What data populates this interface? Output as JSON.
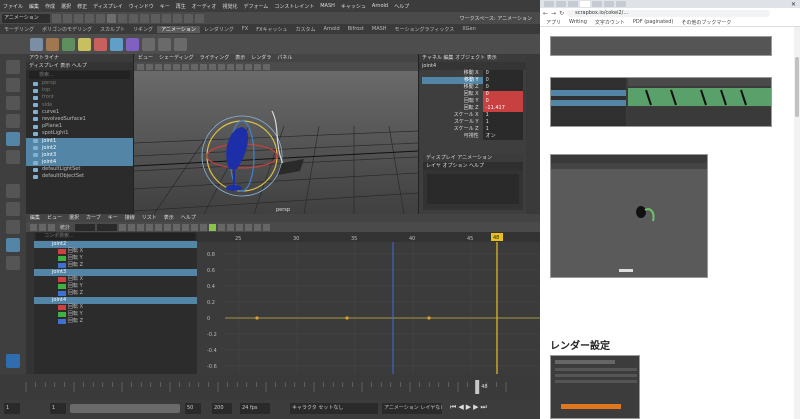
{
  "maya": {
    "menu": [
      "ファイル",
      "編集",
      "作成",
      "選択",
      "修正",
      "ディスプレイ",
      "ウィンドウ",
      "キー",
      "再生",
      "オーディオ",
      "視覚化",
      "デフォーム",
      "コンストレイント",
      "MASH",
      "キャッシュ",
      "Arnold",
      "ヘルプ"
    ],
    "workspace_label": "ワークスペース: アニメーション",
    "mode": "アニメーション",
    "shelf_tabs": [
      "モーデリング",
      "ポリゴンのモデリング",
      "スカルプト",
      "リギング",
      "アニメーション",
      "レンダリング",
      "FX",
      "FXキャッシュ",
      "カスタム",
      "Arnold",
      "Bifrost",
      "MASH",
      "モーショングラフィックス",
      "XGen"
    ],
    "shelf_active_index": 4,
    "outliner": {
      "title": "アウトライナ",
      "menu": "ディスプレイ  表示  ヘルプ",
      "search_placeholder": "検索...",
      "items": [
        {
          "label": "persp",
          "sel": false,
          "dim": true
        },
        {
          "label": "top",
          "sel": false,
          "dim": true
        },
        {
          "label": "front",
          "sel": false,
          "dim": true
        },
        {
          "label": "side",
          "sel": false,
          "dim": true
        },
        {
          "label": "curve1",
          "sel": false
        },
        {
          "label": "revolvedSurface1",
          "sel": false
        },
        {
          "label": "pPlane1",
          "sel": false
        },
        {
          "label": "spotLight1",
          "sel": false
        },
        {
          "label": "joint1",
          "sel": true
        },
        {
          "label": "joint2",
          "sel": true
        },
        {
          "label": "joint3",
          "sel": true
        },
        {
          "label": "joint4",
          "sel": true
        },
        {
          "label": "defaultLightSet",
          "sel": false
        },
        {
          "label": "defaultObjectSet",
          "sel": false
        }
      ]
    },
    "viewport": {
      "menu": [
        "ビュー",
        "シェーディング",
        "ライティング",
        "表示",
        "レンダラ",
        "パネル"
      ],
      "camera_label": "persp"
    },
    "channel_box": {
      "tabs": [
        "チャネル",
        "編集",
        "オブジェクト",
        "表示"
      ],
      "object": "joint4",
      "rows": [
        {
          "label": "移動 X",
          "value": "0",
          "sel": false
        },
        {
          "label": "移動 Y",
          "value": "0",
          "sel": true
        },
        {
          "label": "移動 Z",
          "value": "0",
          "sel": false
        },
        {
          "label": "回転 X",
          "value": "0",
          "sel": false,
          "red": true
        },
        {
          "label": "回転 Y",
          "value": "0",
          "sel": false,
          "red": true
        },
        {
          "label": "回転 Z",
          "value": "-11.417",
          "sel": false,
          "red": true
        },
        {
          "label": "スケール X",
          "value": "1",
          "sel": false
        },
        {
          "label": "スケール Y",
          "value": "1",
          "sel": false
        },
        {
          "label": "スケール Z",
          "value": "1",
          "sel": false
        },
        {
          "label": "可視性",
          "value": "オン",
          "sel": false
        }
      ],
      "layer_tabs": "ディスプレイ  アニメーション",
      "layer_menu": "レイヤ  オプション  ヘルプ"
    },
    "graph_editor": {
      "menu": [
        "編集",
        "ビュー",
        "選択",
        "カーブ",
        "キー",
        "接線",
        "リスト",
        "表示",
        "ヘルプ"
      ],
      "stats_label": "統計",
      "search_placeholder": "コンポ検索...",
      "y_ticks": [
        "0.8",
        "0.6",
        "0.4",
        "0.2",
        "0",
        "-0.2",
        "-0.4",
        "-0.6"
      ],
      "x_ticks": [
        "25",
        "30",
        "35",
        "40",
        "45"
      ],
      "current_frame": "48",
      "tree": [
        {
          "label": "joint2",
          "type": "joint"
        },
        {
          "label": "回転 X",
          "type": "channel",
          "color": "#d04040"
        },
        {
          "label": "回転 Y",
          "type": "channel",
          "color": "#40b040"
        },
        {
          "label": "回転 Z",
          "type": "channel",
          "color": "#4070d0"
        },
        {
          "label": "joint3",
          "type": "joint"
        },
        {
          "label": "回転 X",
          "type": "channel",
          "color": "#d04040"
        },
        {
          "label": "回転 Y",
          "type": "channel",
          "color": "#40b040"
        },
        {
          "label": "回転 Z",
          "type": "channel",
          "color": "#4070d0"
        },
        {
          "label": "joint4",
          "type": "joint"
        },
        {
          "label": "回転 X",
          "type": "channel",
          "color": "#d04040"
        },
        {
          "label": "回転 Y",
          "type": "channel",
          "color": "#40b040"
        },
        {
          "label": "回転 Z",
          "type": "channel",
          "color": "#4070d0"
        }
      ]
    },
    "timeline": {
      "start": "1",
      "range_start": "1",
      "range_end": "50",
      "end": "200",
      "fps": "24 fps",
      "char_set": "キャラクタ セットなし",
      "anim_layer": "アニメーション レイヤなし",
      "current": "48"
    }
  },
  "browser": {
    "url": "scrapbox.io/cokei2/...",
    "bookmarks": [
      "アプリ",
      "Writing",
      "文字カウント",
      "PDF (paginated)",
      "その他のブックマーク"
    ],
    "heading": "レンダー設定",
    "accent": "#1a73e8"
  }
}
